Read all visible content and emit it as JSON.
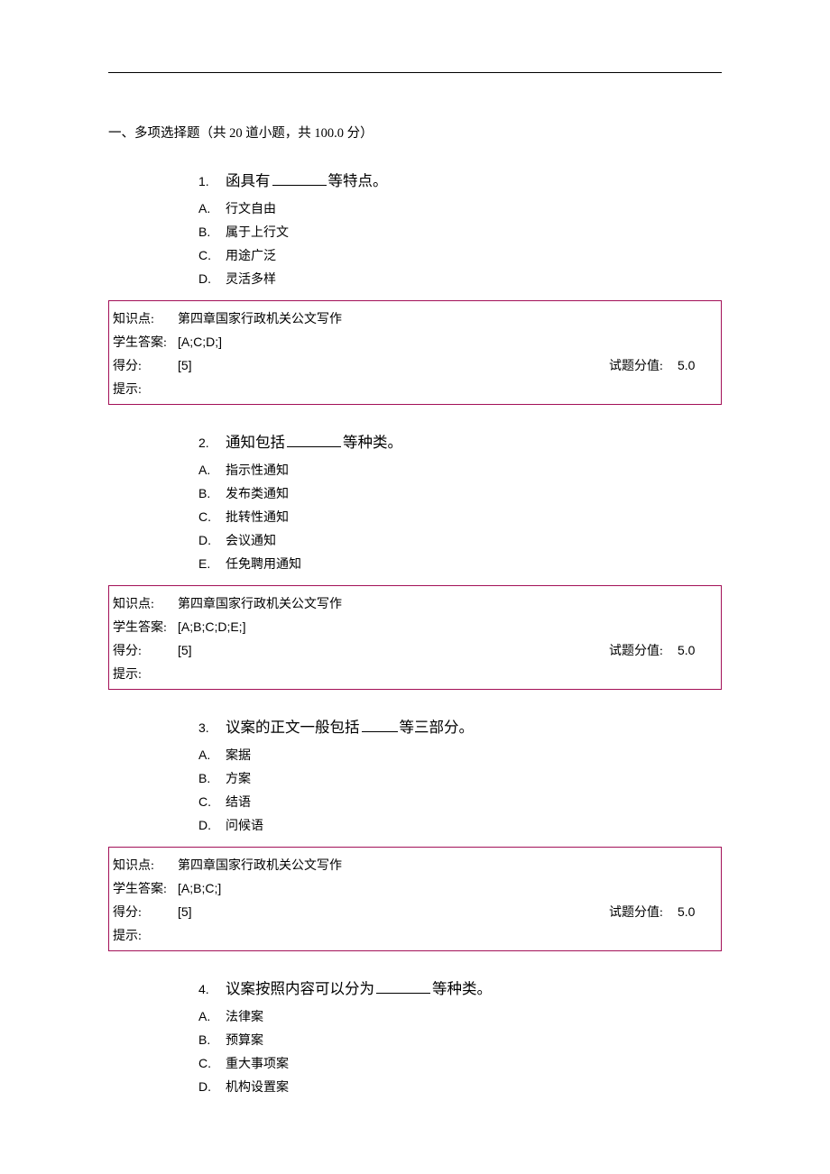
{
  "section_header": "一、多项选择题（共 20 道小题，共 100.0 分）",
  "labels": {
    "knowledge": "知识点:",
    "student_answer": "学生答案:",
    "score_got": "得分:",
    "score_full": "试题分值:",
    "hint": "提示:"
  },
  "questions": [
    {
      "num": "1.",
      "stem_pre": "函具有",
      "stem_post": "等特点。",
      "blank_class": "blank",
      "options": [
        {
          "letter": "A.",
          "text": "行文自由"
        },
        {
          "letter": "B.",
          "text": "属于上行文"
        },
        {
          "letter": "C.",
          "text": "用途广泛"
        },
        {
          "letter": "D.",
          "text": "灵活多样"
        }
      ],
      "knowledge": "第四章国家行政机关公文写作",
      "student_answer": "[A;C;D;]",
      "score_got": "[5]",
      "score_full": "5.0",
      "hint": ""
    },
    {
      "num": "2.",
      "stem_pre": "通知包括",
      "stem_post": "等种类。",
      "blank_class": "blank",
      "options": [
        {
          "letter": "A.",
          "text": "指示性通知"
        },
        {
          "letter": "B.",
          "text": "发布类通知"
        },
        {
          "letter": "C.",
          "text": "批转性通知"
        },
        {
          "letter": "D.",
          "text": "会议通知"
        },
        {
          "letter": "E.",
          "text": "任免聘用通知"
        }
      ],
      "knowledge": "第四章国家行政机关公文写作",
      "student_answer": "[A;B;C;D;E;]",
      "score_got": "[5]",
      "score_full": "5.0",
      "hint": ""
    },
    {
      "num": "3.",
      "stem_pre": "议案的正文一般包括",
      "stem_post": "等三部分。",
      "blank_class": "blank short",
      "options": [
        {
          "letter": "A.",
          "text": "案据"
        },
        {
          "letter": "B.",
          "text": "方案"
        },
        {
          "letter": "C.",
          "text": "结语"
        },
        {
          "letter": "D.",
          "text": "问候语"
        }
      ],
      "knowledge": "第四章国家行政机关公文写作",
      "student_answer": "[A;B;C;]",
      "score_got": "[5]",
      "score_full": "5.0",
      "hint": ""
    },
    {
      "num": "4.",
      "stem_pre": "议案按照内容可以分为",
      "stem_post": "等种类。",
      "blank_class": "blank",
      "options": [
        {
          "letter": "A.",
          "text": "法律案"
        },
        {
          "letter": "B.",
          "text": "预算案"
        },
        {
          "letter": "C.",
          "text": "重大事项案"
        },
        {
          "letter": "D.",
          "text": "机构设置案"
        }
      ],
      "knowledge": null,
      "student_answer": null,
      "score_got": null,
      "score_full": null,
      "hint": null
    }
  ]
}
